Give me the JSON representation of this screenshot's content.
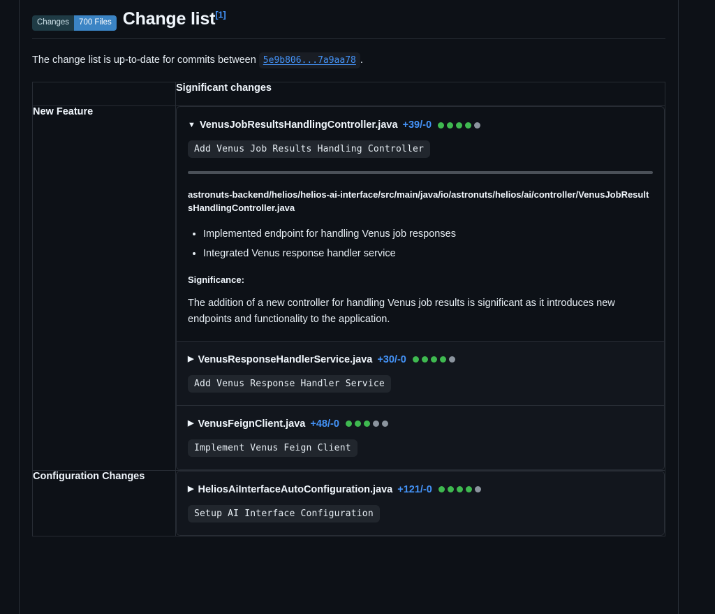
{
  "header": {
    "badge_left": "Changes",
    "badge_right": "700 Files",
    "title": "Change list",
    "footnote_ref": "[1]"
  },
  "intro": {
    "text_before": "The change list is up-to-date for commits between",
    "commit_range": "5e9b806...7a9aa78",
    "text_after": "."
  },
  "table": {
    "header_blank": "",
    "header_significant": "Significant changes",
    "sections": [
      {
        "category": "New Feature",
        "entries": [
          {
            "caret": "▼",
            "expanded": true,
            "filename": "VenusJobResultsHandlingController.java",
            "diffstat": "+39/-0",
            "dots": [
              1,
              1,
              1,
              1,
              0
            ],
            "commit_message": "Add Venus Job Results Handling Controller",
            "filepath": "astronuts-backend/helios/helios-ai-interface/src/main/java/io/astronuts/helios/ai/controller/VenusJobResultsHandlingController.java",
            "bullets": [
              "Implemented endpoint for handling Venus job responses",
              "Integrated Venus response handler service"
            ],
            "significance_label": "Significance:",
            "significance_text": "The addition of a new controller for handling Venus job results is significant as it introduces new endpoints and functionality to the application."
          },
          {
            "caret": "▶",
            "expanded": false,
            "filename": "VenusResponseHandlerService.java",
            "diffstat": "+30/-0",
            "dots": [
              1,
              1,
              1,
              1,
              0
            ],
            "commit_message": "Add Venus Response Handler Service"
          },
          {
            "caret": "▶",
            "expanded": false,
            "filename": "VenusFeignClient.java",
            "diffstat": "+48/-0",
            "dots": [
              1,
              1,
              1,
              0,
              0
            ],
            "commit_message": "Implement Venus Feign Client"
          }
        ]
      },
      {
        "category": "Configuration Changes",
        "entries": [
          {
            "caret": "▶",
            "expanded": false,
            "filename": "HeliosAiInterfaceAutoConfiguration.java",
            "diffstat": "+121/-0",
            "dots": [
              1,
              1,
              1,
              1,
              0
            ],
            "commit_message": "Setup AI Interface Configuration"
          }
        ]
      }
    ]
  },
  "colors": {
    "background": "#0d1117",
    "accent_blue": "#4493f8",
    "badge_blue": "#3b84c4",
    "badge_dark": "#1f3b45",
    "dot_on": "#3fb950",
    "dot_off": "#8b949e",
    "border": "#272c34"
  }
}
